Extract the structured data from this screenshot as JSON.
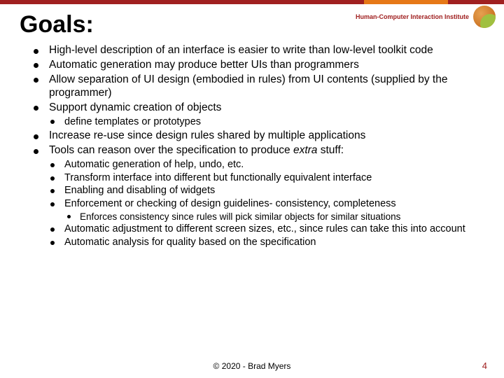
{
  "title": "Goals:",
  "brand": "Human-Computer Interaction Institute",
  "bullets": {
    "b1": "High-level description of an interface is easier to write than low-level toolkit code",
    "b2": "Automatic generation may produce better UIs than programmers",
    "b3": "Allow separation of UI design (embodied in rules) from UI contents (supplied by the programmer)",
    "b4": "Support dynamic creation of objects",
    "b4a": "define templates or prototypes",
    "b5": "Increase re-use since design rules shared by multiple applications",
    "b6pre": "Tools can reason over the specification to produce ",
    "b6em": "extra",
    "b6post": " stuff:",
    "b6a": "Automatic generation of help, undo, etc.",
    "b6b": "Transform interface into different but functionally equivalent interface",
    "b6c": "Enabling and disabling of widgets",
    "b6d": "Enforcement or checking of design guidelines- consistency, completeness",
    "b6d1": "Enforces consistency since rules will pick similar objects for similar situations",
    "b6e": "Automatic adjustment to different screen sizes, etc., since rules can take this into account",
    "b6f": "Automatic analysis for quality based on the specification"
  },
  "footer": "© 2020 - Brad Myers",
  "pagenum": "4"
}
